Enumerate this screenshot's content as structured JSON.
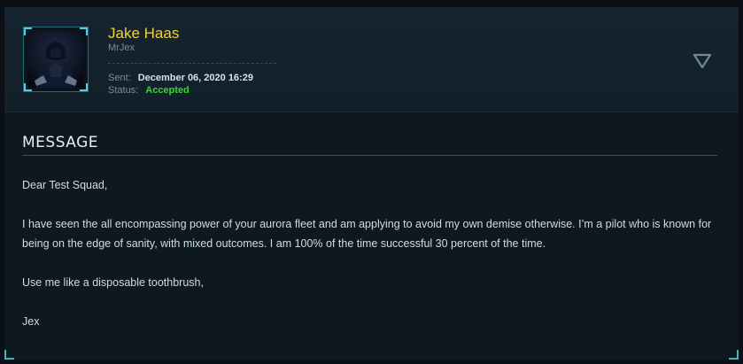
{
  "sender": {
    "name": "Jake Haas",
    "handle": "MrJex"
  },
  "meta": {
    "sent_label": "Sent:",
    "sent_value": "December 06, 2020 16:29",
    "status_label": "Status:",
    "status_value": "Accepted"
  },
  "colors": {
    "accent": "#3fb6c4",
    "name": "#f0d23a",
    "status_accepted": "#39d439"
  },
  "icons": {
    "toggle": "triangle-down-icon"
  },
  "message": {
    "section_title": "MESSAGE",
    "greeting": "Dear Test Squad,",
    "paragraph": "I have seen the all encompassing power of your aurora fleet and am applying to avoid my own demise otherwise. I’m a pilot who is known for being on the edge of sanity, with mixed outcomes. I am 100% of the time successful 30 percent of the time.",
    "closing": "Use me like a disposable toothbrush,",
    "signature": "Jex"
  }
}
